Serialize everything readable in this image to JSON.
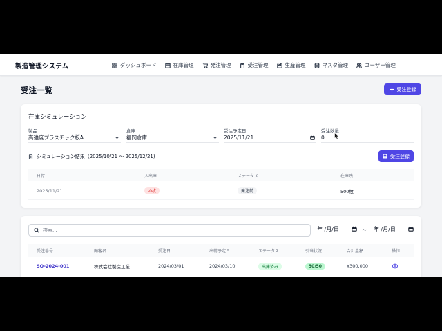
{
  "app": {
    "title": "製造管理システム"
  },
  "nav": [
    {
      "label": "ダッシュボード",
      "icon": "grid-icon"
    },
    {
      "label": "在庫管理",
      "icon": "box-icon"
    },
    {
      "label": "発注管理",
      "icon": "cart-icon"
    },
    {
      "label": "受注管理",
      "icon": "clipboard-icon"
    },
    {
      "label": "生産管理",
      "icon": "factory-icon"
    },
    {
      "label": "マスタ管理",
      "icon": "database-icon"
    },
    {
      "label": "ユーザー管理",
      "icon": "users-icon"
    }
  ],
  "page": {
    "title": "受注一覧",
    "add_button": "受注登録"
  },
  "simulation": {
    "title": "在庫シミュレーション",
    "fields": {
      "product": {
        "label": "製品",
        "value": "高強度プラスチック板A"
      },
      "warehouse": {
        "label": "倉庫",
        "value": "福岡倉庫"
      },
      "due_date": {
        "label": "受注予定日",
        "value": "2025/11/21"
      },
      "quantity": {
        "label": "受注数量",
        "value": "0"
      }
    },
    "result_label": "シミュレーション結果（2025/10/21 ～ 2025/12/21)",
    "register_button": "受注登録",
    "table": {
      "headers": [
        "日付",
        "入出庫",
        "ステータス",
        "在庫残"
      ],
      "rows": [
        {
          "date": "2025/11/21",
          "movement": "-0枚",
          "status": "発注前",
          "stock": "500枚"
        }
      ]
    }
  },
  "orders": {
    "search_placeholder": "検索...",
    "date_from": "年 /月/日",
    "date_to": "年 /月/日",
    "date_separator": "～",
    "headers": [
      "受注番号",
      "顧客名",
      "受注日",
      "出荷予定日",
      "ステータス",
      "引当状況",
      "合計金額",
      "操作"
    ],
    "rows": [
      {
        "order_no": "SO-2024-001",
        "customer": "株式会社製造工業",
        "order_date": "2024/03/01",
        "ship_date": "2024/03/10",
        "status": "出庫済み",
        "allocation": "50/50",
        "total": "¥300,000"
      }
    ]
  },
  "colors": {
    "primary": "#4f46e5",
    "link": "#4338ca",
    "danger_bg": "#fee2e2",
    "success_bg": "#dcfce7"
  }
}
